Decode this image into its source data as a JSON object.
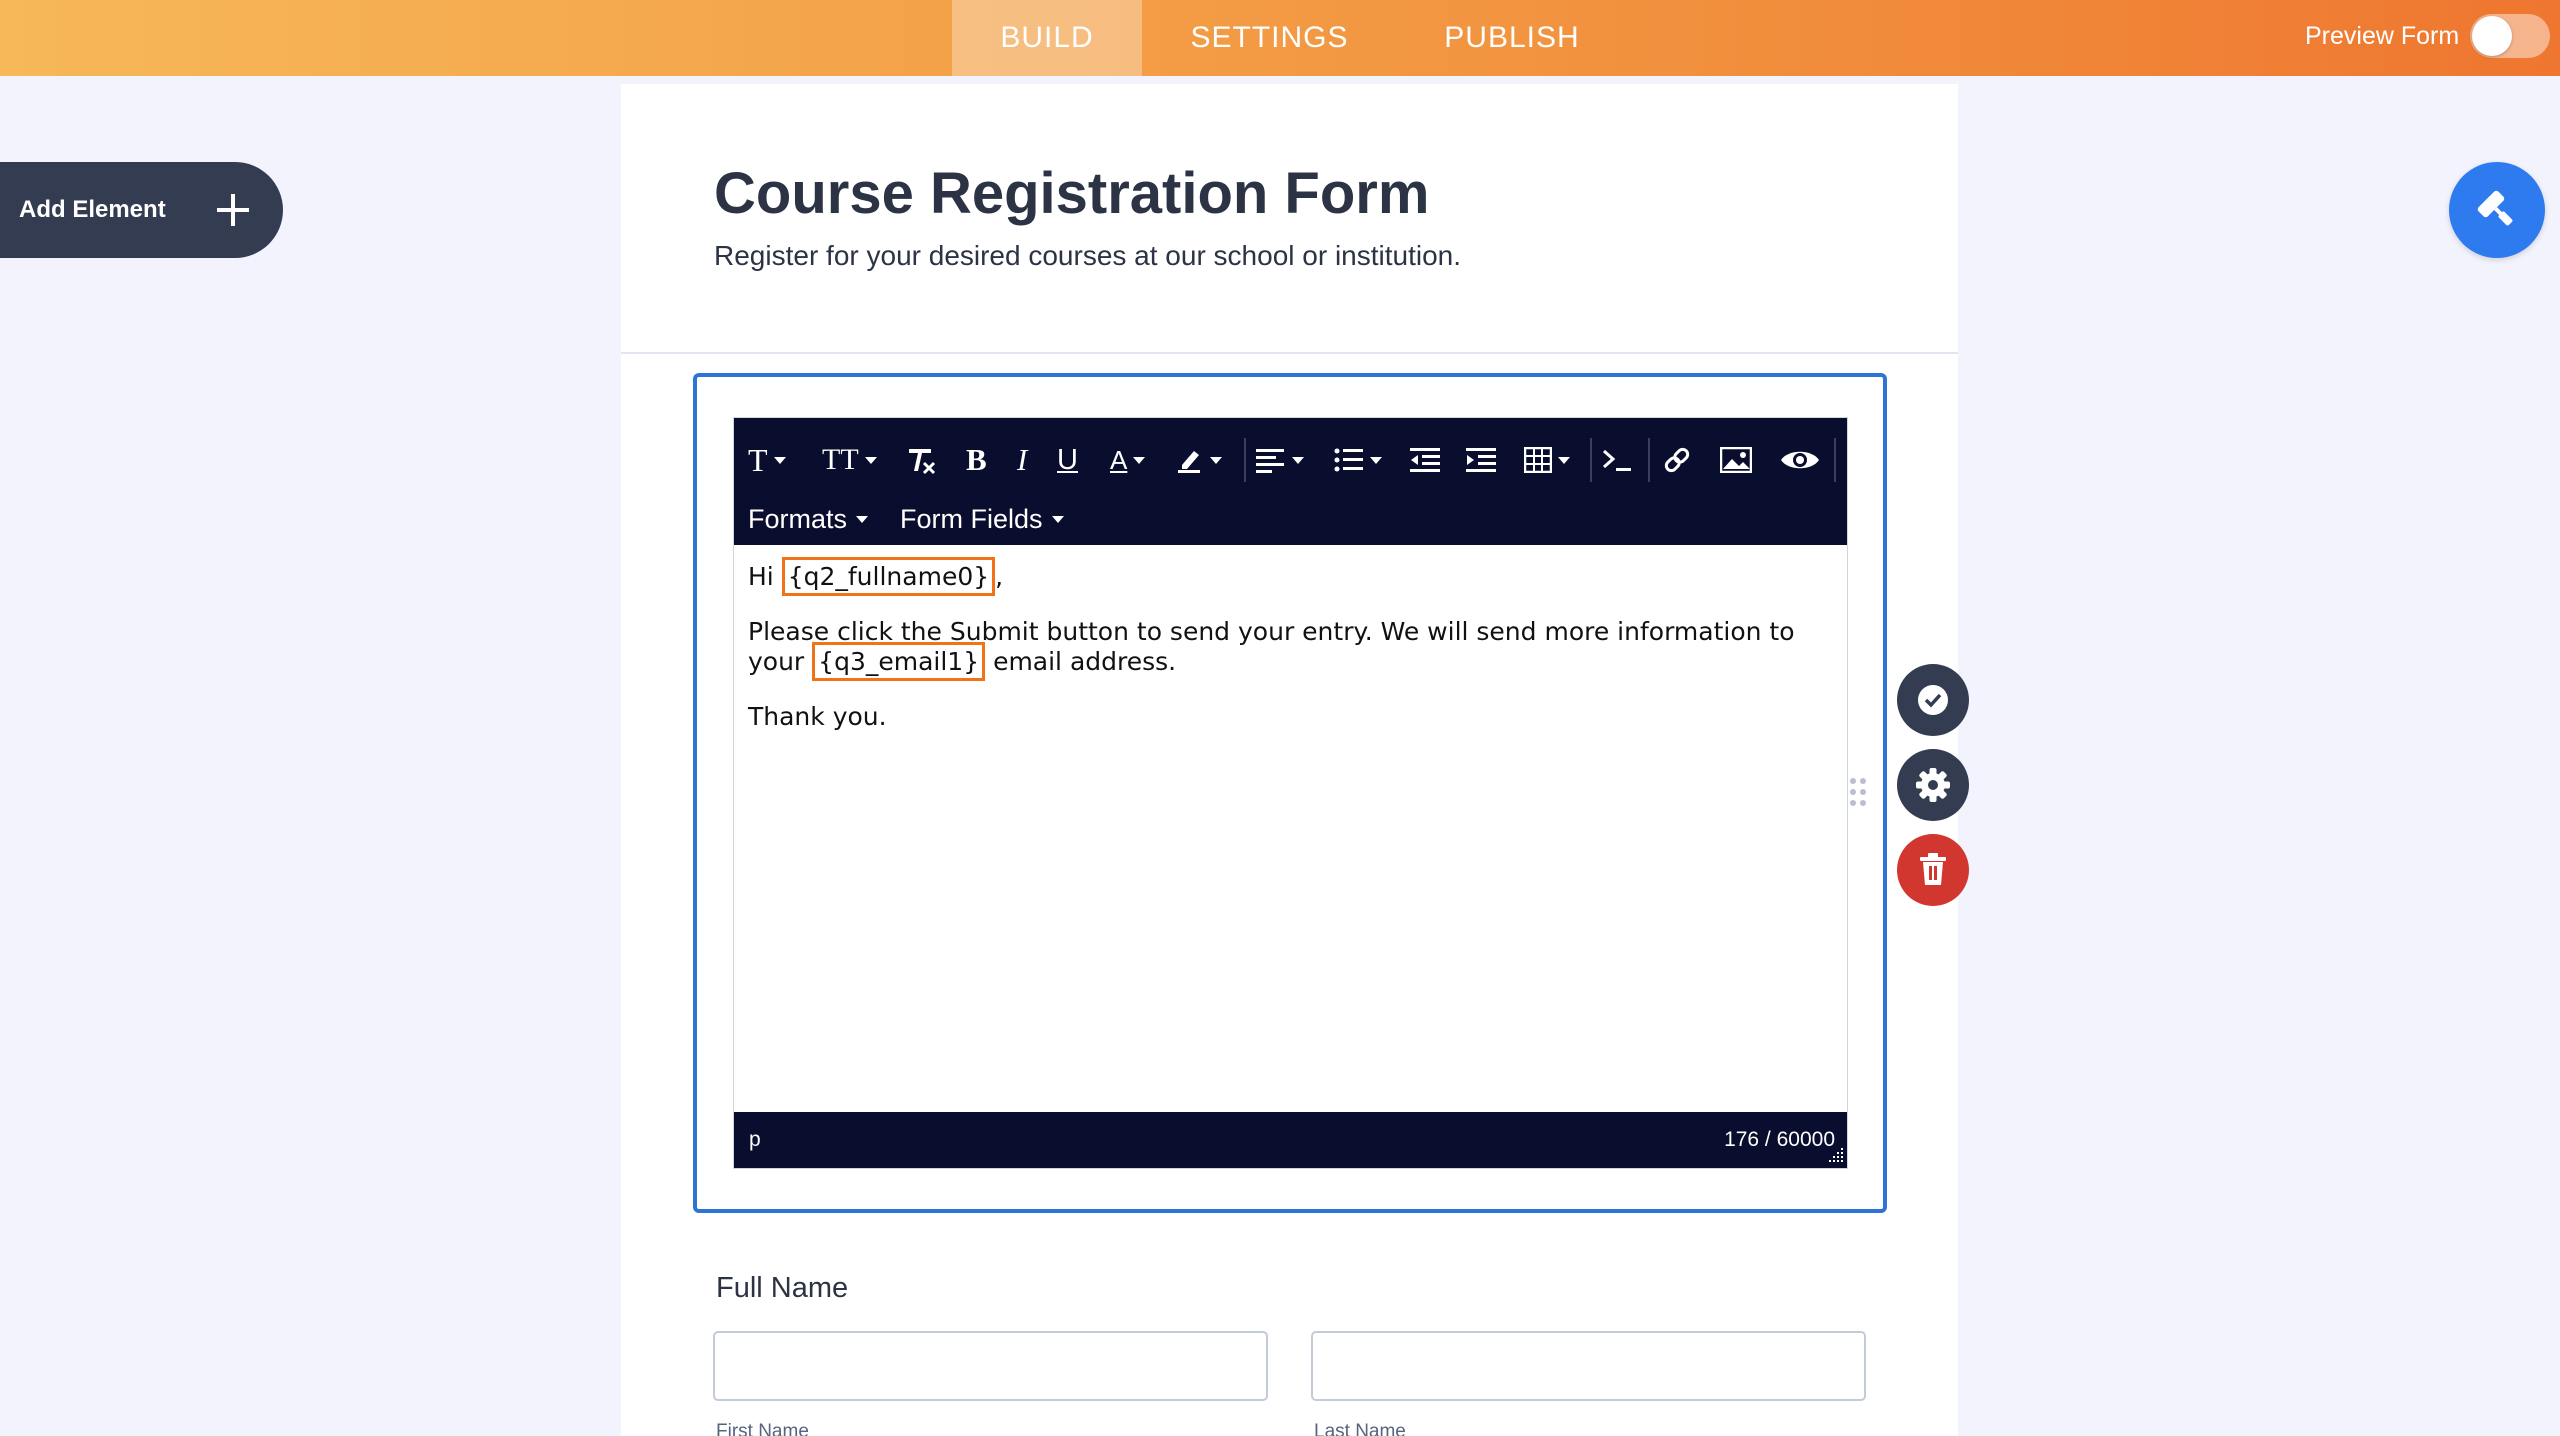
{
  "topbar": {
    "tabs": [
      {
        "label": "BUILD"
      },
      {
        "label": "SETTINGS"
      },
      {
        "label": "PUBLISH"
      }
    ],
    "preview_label": "Preview Form",
    "preview_enabled": false
  },
  "sidebar": {
    "add_element_label": "Add Element"
  },
  "form": {
    "title": "Course Registration Form",
    "subtitle": "Register for your desired courses at our school or institution."
  },
  "editor": {
    "toolbar": {
      "icons": [
        "font-family-icon",
        "font-size-icon",
        "clear-format-icon",
        "bold-icon",
        "italic-icon",
        "underline-icon",
        "text-color-icon",
        "highlight-icon",
        "align-icon",
        "bullet-list-icon",
        "outdent-icon",
        "indent-icon",
        "table-icon",
        "code-icon",
        "link-icon",
        "image-icon",
        "preview-eye-icon"
      ],
      "bold": "B",
      "italic": "I",
      "underline": "U",
      "text_color": "A",
      "font_family": "T",
      "font_size": "TT"
    },
    "menus": {
      "formats": "Formats",
      "form_fields": "Form Fields"
    },
    "content": {
      "line1_prefix": "Hi",
      "line1_tag": "{q2_fullname0}",
      "line1_suffix": ",",
      "line2_a": "Please click the Submit button to send your entry. We will send more information to your",
      "line2_tag": "{q3_email1}",
      "line2_b": "email address.",
      "line3": "Thank you."
    },
    "status_path": "p",
    "char_count": "176 / 60000"
  },
  "full_name": {
    "label": "Full Name",
    "first_label": "First Name",
    "last_label": "Last Name",
    "first_value": "",
    "last_value": ""
  },
  "colors": {
    "accent_blue": "#2e74d6",
    "tag_orange": "#f07318",
    "toolbar_bg": "#0a0e2e",
    "delete_red": "#d1372e"
  }
}
